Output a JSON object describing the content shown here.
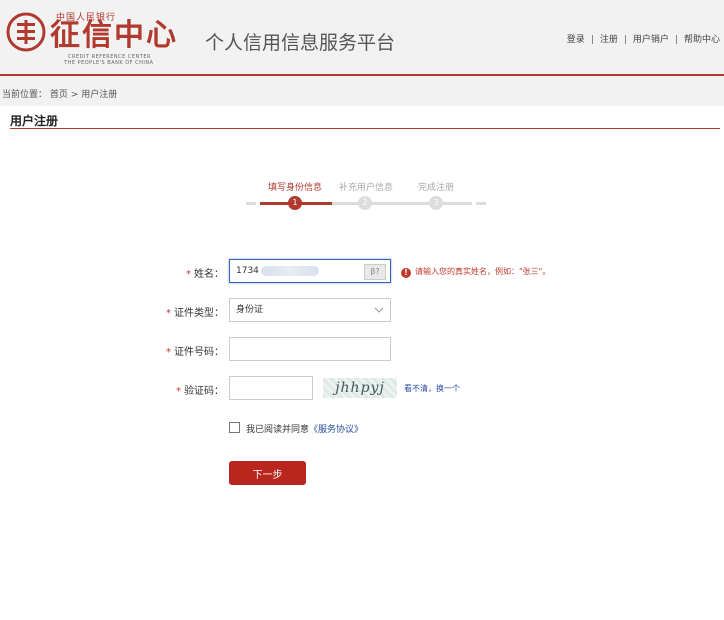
{
  "header": {
    "logo_top": "中国人民银行",
    "logo_main": "征信中心",
    "logo_en_line1": "CREDIT REFERENCE CENTER",
    "logo_en_line2": "THE PEOPLE'S BANK OF CHINA",
    "site_title": "个人信用信息服务平台",
    "links": [
      "登录",
      "注册",
      "用户销户",
      "帮助中心"
    ],
    "separator": "|"
  },
  "breadcrumb": {
    "prefix": "当前位置：",
    "home": "首页",
    "arrow": ">",
    "current": "用户注册"
  },
  "page_title": "用户注册",
  "steps": [
    {
      "label": "填写身份信息",
      "number": "1",
      "active": true
    },
    {
      "label": "补充用户信息",
      "number": "2",
      "active": false
    },
    {
      "label": "完成注册",
      "number": "3",
      "active": false
    }
  ],
  "form": {
    "required_mark": "*",
    "name": {
      "label": "姓名：",
      "value": "1734",
      "icon_text": "β?",
      "error": "请输入您的真实姓名，例如：\"张三\"。",
      "error_icon": "!"
    },
    "id_type": {
      "label": "证件类型：",
      "selected": "身份证"
    },
    "id_number": {
      "label": "证件号码：",
      "value": ""
    },
    "captcha": {
      "label": "验证码：",
      "value": "",
      "image_text": "jhhpyj",
      "refresh": "看不清，换一个"
    },
    "agree_prefix": "我已阅读并同意",
    "agree_link": "《服务协议》"
  },
  "next_button": "下一步",
  "colors": {
    "brand_red": "#b03a2e",
    "link_blue": "#2a4ea0"
  }
}
